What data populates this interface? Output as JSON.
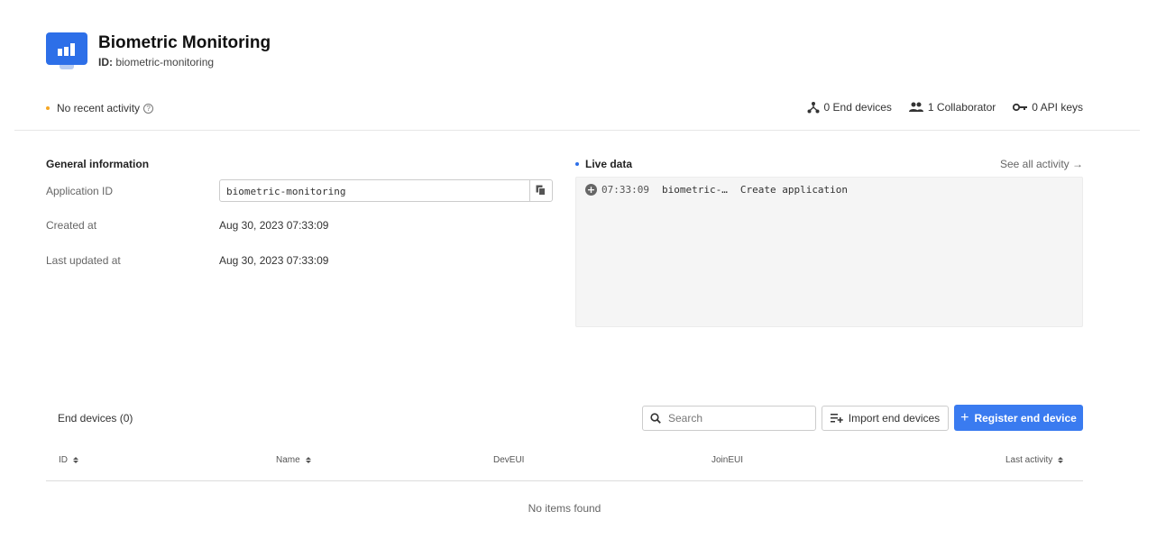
{
  "app": {
    "title": "Biometric Monitoring",
    "id_label": "ID:",
    "id_value": "biometric-monitoring"
  },
  "status": {
    "activity": "No recent activity",
    "end_devices": "0 End devices",
    "collaborators": "1 Collaborator",
    "api_keys": "0 API keys"
  },
  "general": {
    "title": "General information",
    "app_id_label": "Application ID",
    "app_id_value": "biometric-monitoring",
    "created_label": "Created at",
    "created_value": "Aug 30, 2023 07:33:09",
    "updated_label": "Last updated at",
    "updated_value": "Aug 30, 2023 07:33:09"
  },
  "live": {
    "title": "Live data",
    "see_all": "See all activity →",
    "events": [
      {
        "time": "07:33:09",
        "entity": "biometric-…",
        "action": "Create application"
      }
    ]
  },
  "end_devices": {
    "title": "End devices (0)",
    "search_placeholder": "Search",
    "import_label": "Import end devices",
    "register_label": "Register end device",
    "columns": [
      "ID",
      "Name",
      "DevEUI",
      "JoinEUI",
      "Last activity"
    ],
    "empty": "No items found"
  },
  "colors": {
    "accent": "#3a7bf0",
    "activity_dot": "#f5a623",
    "live_dot": "#2d6fe8"
  }
}
